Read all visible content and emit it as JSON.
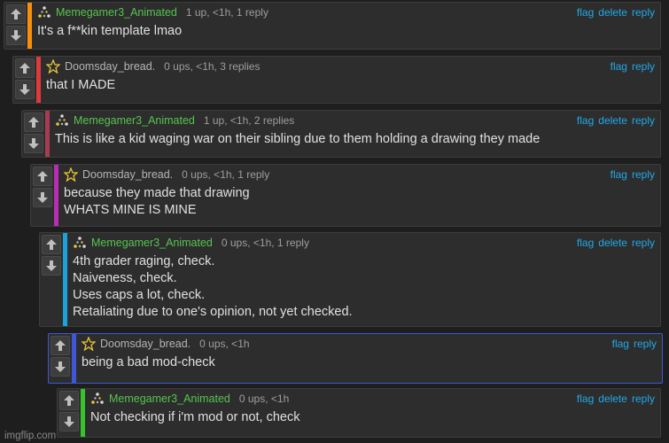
{
  "actions": {
    "flag": "flag",
    "delete": "delete",
    "reply": "reply"
  },
  "watermark": "imgflip.com",
  "comments": [
    {
      "user": "Memegamer3_Animated",
      "stats": "1 up, <1h, 1 reply",
      "text": "It's a f**kin template lmao",
      "stripe": "#f5900b",
      "avatar": "dot-triangle-icon",
      "has_delete": true
    },
    {
      "user": "Doomsday_bread.",
      "stats": "0 ups, <1h, 3 replies",
      "text": "that I MADE",
      "stripe": "#e0393b",
      "avatar": "star-icon",
      "has_delete": false
    },
    {
      "user": "Memegamer3_Animated",
      "stats": "1 up, <1h, 2 replies",
      "text": "This is like a kid waging war on their sibling due to them holding a drawing they made",
      "stripe": "#a63c53",
      "avatar": "dot-triangle-icon",
      "has_delete": true
    },
    {
      "user": "Doomsday_bread.",
      "stats": "0 ups, <1h, 1 reply",
      "text": "because they made that drawing\nWHATS MINE IS MINE",
      "stripe": "#bb2bb8",
      "avatar": "star-icon",
      "has_delete": false
    },
    {
      "user": "Memegamer3_Animated",
      "stats": "0 ups, <1h, 1 reply",
      "text": "4th grader raging, check.\nNaiveness, check.\nUses caps a lot, check.\nRetaliating due to one's opinion, not yet checked.",
      "stripe": "#1ca2d8",
      "avatar": "dot-triangle-icon",
      "has_delete": true
    },
    {
      "user": "Doomsday_bread.",
      "stats": "0 ups, <1h",
      "text": "being a bad mod-check",
      "stripe": "#3d57d7",
      "avatar": "star-icon",
      "has_delete": false
    },
    {
      "user": "Memegamer3_Animated",
      "stats": "0 ups, <1h",
      "text": "Not checking if i'm mod or not, check",
      "stripe": "#35c42a",
      "avatar": "dot-triangle-icon",
      "has_delete": true
    }
  ]
}
